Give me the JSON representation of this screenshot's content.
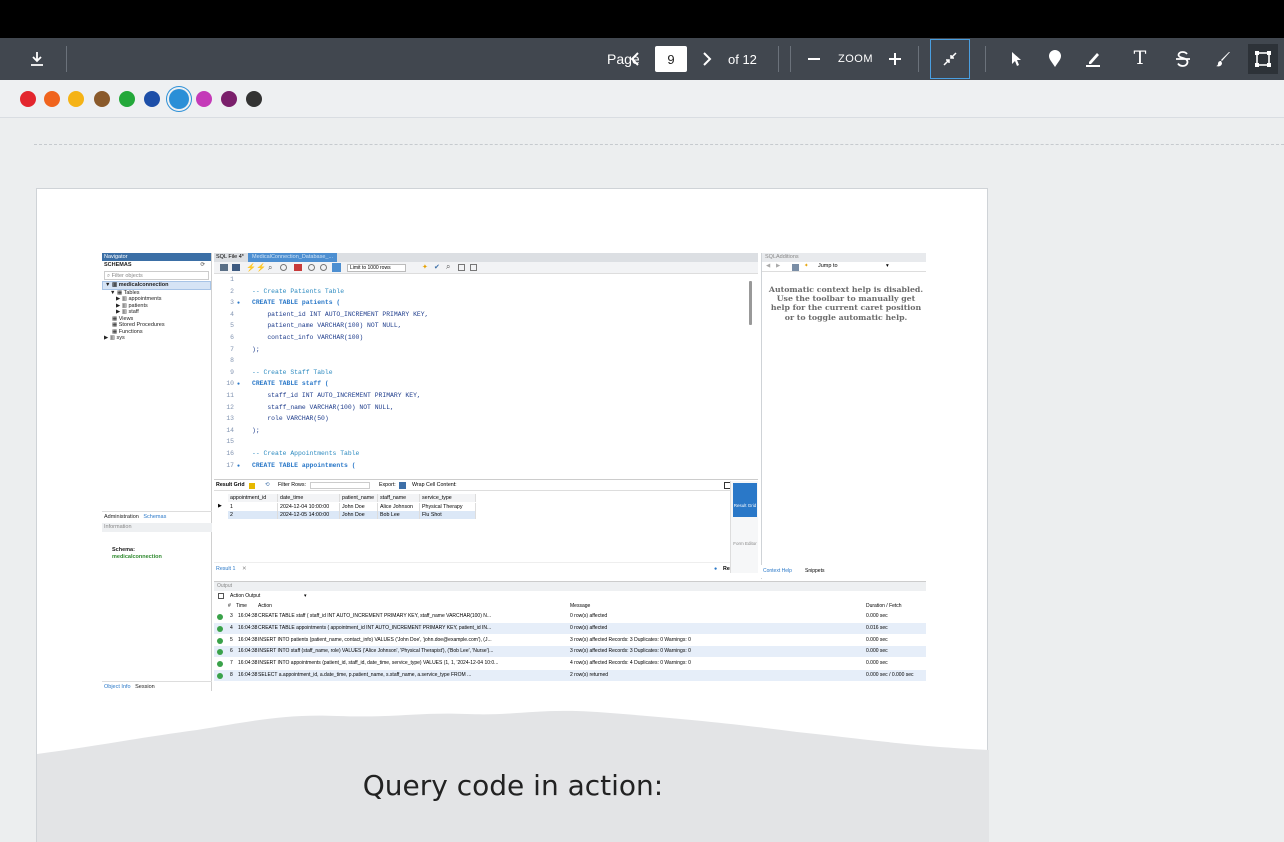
{
  "toolbar": {
    "page_label": "Page",
    "page_value": "9",
    "of_label": "of 12",
    "zoom_label": "ZOOM",
    "text_tool": "T"
  },
  "palette": {
    "colors": [
      "#e3262e",
      "#f0641e",
      "#f5b316",
      "#8a5a2b",
      "#23a83a",
      "#1d4fa8",
      "#2a8fd7",
      "#c43ab8",
      "#7a1f6b",
      "#333333"
    ],
    "selected_index": 6
  },
  "workbench": {
    "nav_title": "Navigator",
    "schemas_label": "SCHEMAS",
    "filter_placeholder": "Filter objects",
    "db_name": "medicalconnection",
    "tables_label": "Tables",
    "tables": [
      "appointments",
      "patients",
      "staff"
    ],
    "views_label": "Views",
    "sp_label": "Stored Procedures",
    "func_label": "Functions",
    "sys_label": "sys",
    "tab_admin": "Administration",
    "tab_schemas": "Schemas",
    "info_label": "Information",
    "schema_label": "Schema:",
    "schema_value": "medicalconnection",
    "tab_objinfo": "Object Info",
    "tab_session": "Session",
    "sql_tab": "SQL File 4*",
    "sql_tab2": "MedicalConnection_Database_...",
    "limit_label": "Limit to 1000 rows",
    "code": [
      {
        "n": "1",
        "t": ""
      },
      {
        "n": "2",
        "t": "-- Create Patients Table",
        "c": "cm"
      },
      {
        "n": "3",
        "t": "CREATE TABLE patients (",
        "c": "kw",
        "dot": "●"
      },
      {
        "n": "4",
        "t": "    patient_id INT AUTO_INCREMENT PRIMARY KEY,"
      },
      {
        "n": "5",
        "t": "    patient_name VARCHAR(100) NOT NULL,"
      },
      {
        "n": "6",
        "t": "    contact_info VARCHAR(100)"
      },
      {
        "n": "7",
        "t": ");"
      },
      {
        "n": "8",
        "t": ""
      },
      {
        "n": "9",
        "t": "-- Create Staff Table",
        "c": "cm"
      },
      {
        "n": "10",
        "t": "CREATE TABLE staff (",
        "c": "kw",
        "dot": "●"
      },
      {
        "n": "11",
        "t": "    staff_id INT AUTO_INCREMENT PRIMARY KEY,"
      },
      {
        "n": "12",
        "t": "    staff_name VARCHAR(100) NOT NULL,"
      },
      {
        "n": "13",
        "t": "    role VARCHAR(50)"
      },
      {
        "n": "14",
        "t": ");"
      },
      {
        "n": "15",
        "t": ""
      },
      {
        "n": "16",
        "t": "-- Create Appointments Table",
        "c": "cm"
      },
      {
        "n": "17",
        "t": "CREATE TABLE appointments (",
        "c": "kw",
        "dot": "●"
      }
    ],
    "sqladd_title": "SQLAdditions",
    "jump_label": "Jump to",
    "help_text": "Automatic context help is disabled. Use the toolbar to manually get help for the current caret position or to toggle automatic help.",
    "result_grid_label": "Result Grid",
    "filter_rows_label": "Filter Rows:",
    "export_label": "Export:",
    "wrap_label": "Wrap Cell Content:",
    "columns": [
      "appointment_id",
      "date_time",
      "patient_name",
      "staff_name",
      "service_type"
    ],
    "rows": [
      [
        "1",
        "2024-12-04 10:00:00",
        "John Doe",
        "Alice Johnson",
        "Physical Therapy"
      ],
      [
        "2",
        "2024-12-05 14:00:00",
        "John Doe",
        "Bob Lee",
        "Flu Shot"
      ]
    ],
    "result_tab": "Result 1",
    "side_result_grid": "Result Grid",
    "side_form_editor": "Form Editor",
    "readonly_label": "Read Only",
    "context_help_tab": "Context Help",
    "snippets_tab": "Snippets",
    "output_label": "Output",
    "action_output_label": "Action Output",
    "out_headers": [
      "#",
      "Time",
      "Action",
      "Message",
      "Duration / Fetch"
    ],
    "out_rows": [
      [
        "3",
        "16:04:38",
        "CREATE TABLE staff (    staff_id INT AUTO_INCREMENT PRIMARY KEY,    staff_name VARCHAR(100) N...",
        "0 row(s) affected",
        "0.000 sec"
      ],
      [
        "4",
        "16:04:38",
        "CREATE TABLE appointments (    appointment_id INT AUTO_INCREMENT PRIMARY KEY,    patient_id IN...",
        "0 row(s) affected",
        "0.016 sec"
      ],
      [
        "5",
        "16:04:38",
        "INSERT INTO patients (patient_name, contact_info) VALUES    ('John Doe', 'john.doe@example.com'),    (J...",
        "3 row(s) affected Records: 3  Duplicates: 0  Warnings: 0",
        "0.000 sec"
      ],
      [
        "6",
        "16:04:38",
        "INSERT INTO staff (staff_name, role) VALUES    ('Alice Johnson', 'Physical Therapist'),    ('Bob Lee', 'Nurse')...",
        "3 row(s) affected Records: 3  Duplicates: 0  Warnings: 0",
        "0.000 sec"
      ],
      [
        "7",
        "16:04:38",
        "INSERT INTO appointments (patient_id, staff_id, date_time, service_type) VALUES    (1, 1, '2024-12-04 10:0...",
        "4 row(s) affected Records: 4  Duplicates: 0  Warnings: 0",
        "0.000 sec"
      ],
      [
        "8",
        "16:04:38",
        "SELECT    a.appointment_id,    a.date_time,    p.patient_name,    s.staff_name,    a.service_type FROM    ...",
        "2 row(s) returned",
        "0.000 sec / 0.000 sec"
      ]
    ]
  },
  "slide": {
    "caption": "Query code in action:"
  }
}
